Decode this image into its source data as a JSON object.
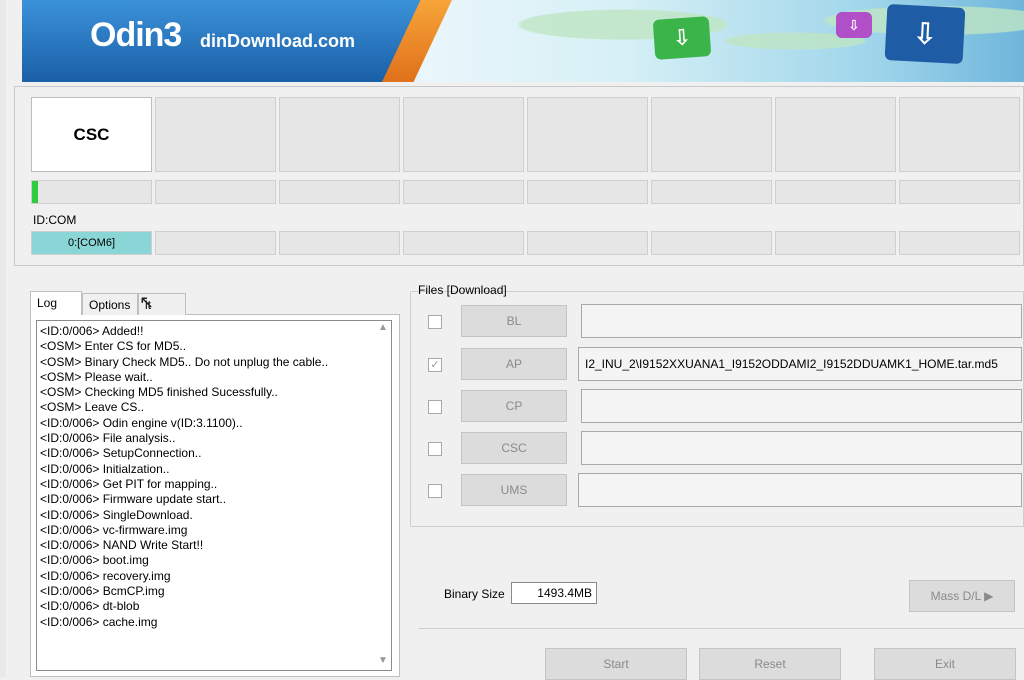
{
  "banner": {
    "logo": "Odin3",
    "site": "dinDownload.com",
    "icon_green": "download-icon",
    "icon_purple": "download-icon",
    "icon_blue": "download-icon"
  },
  "device_grid": {
    "slots": [
      "CSC",
      "",
      "",
      "",
      "",
      "",
      "",
      ""
    ],
    "progress": [
      0.05,
      0,
      0,
      0,
      0,
      0,
      0,
      0
    ],
    "id_com_label": "ID:COM",
    "ports": [
      "0:[COM6]",
      "",
      "",
      "",
      "",
      "",
      "",
      ""
    ]
  },
  "tabs": {
    "log": "Log",
    "options": "Options",
    "pit": "it"
  },
  "log": {
    "lines": [
      "<ID:0/006> Added!!",
      "<OSM> Enter CS for MD5..",
      "<OSM> Binary Check MD5.. Do not unplug the cable..",
      "<OSM> Please wait..",
      "<OSM> Checking MD5 finished Sucessfully..",
      "<OSM> Leave CS..",
      "<ID:0/006> Odin engine v(ID:3.1100)..",
      "<ID:0/006> File analysis..",
      "<ID:0/006> SetupConnection..",
      "<ID:0/006> Initialzation..",
      "<ID:0/006> Get PIT for mapping..",
      "<ID:0/006> Firmware update start..",
      "<ID:0/006> SingleDownload.",
      "<ID:0/006> vc-firmware.img",
      "<ID:0/006> NAND Write Start!!",
      "<ID:0/006> boot.img",
      "<ID:0/006> recovery.img",
      "<ID:0/006> BcmCP.img",
      "<ID:0/006> dt-blob",
      "<ID:0/006> cache.img"
    ]
  },
  "files": {
    "label": "Files [Download]",
    "rows": [
      {
        "name": "BL",
        "checked": false,
        "path": ""
      },
      {
        "name": "AP",
        "checked": true,
        "path": "I2_INU_2\\I9152XXUANA1_I9152ODDAMI2_I9152DDUAMK1_HOME.tar.md5"
      },
      {
        "name": "CP",
        "checked": false,
        "path": ""
      },
      {
        "name": "CSC",
        "checked": false,
        "path": ""
      },
      {
        "name": "UMS",
        "checked": false,
        "path": ""
      }
    ]
  },
  "binary_size": {
    "label": "Binary Size",
    "value": "1493.4MB"
  },
  "buttons": {
    "mass_dl": "Mass D/L ▶",
    "start": "Start",
    "reset": "Reset",
    "exit": "Exit"
  }
}
